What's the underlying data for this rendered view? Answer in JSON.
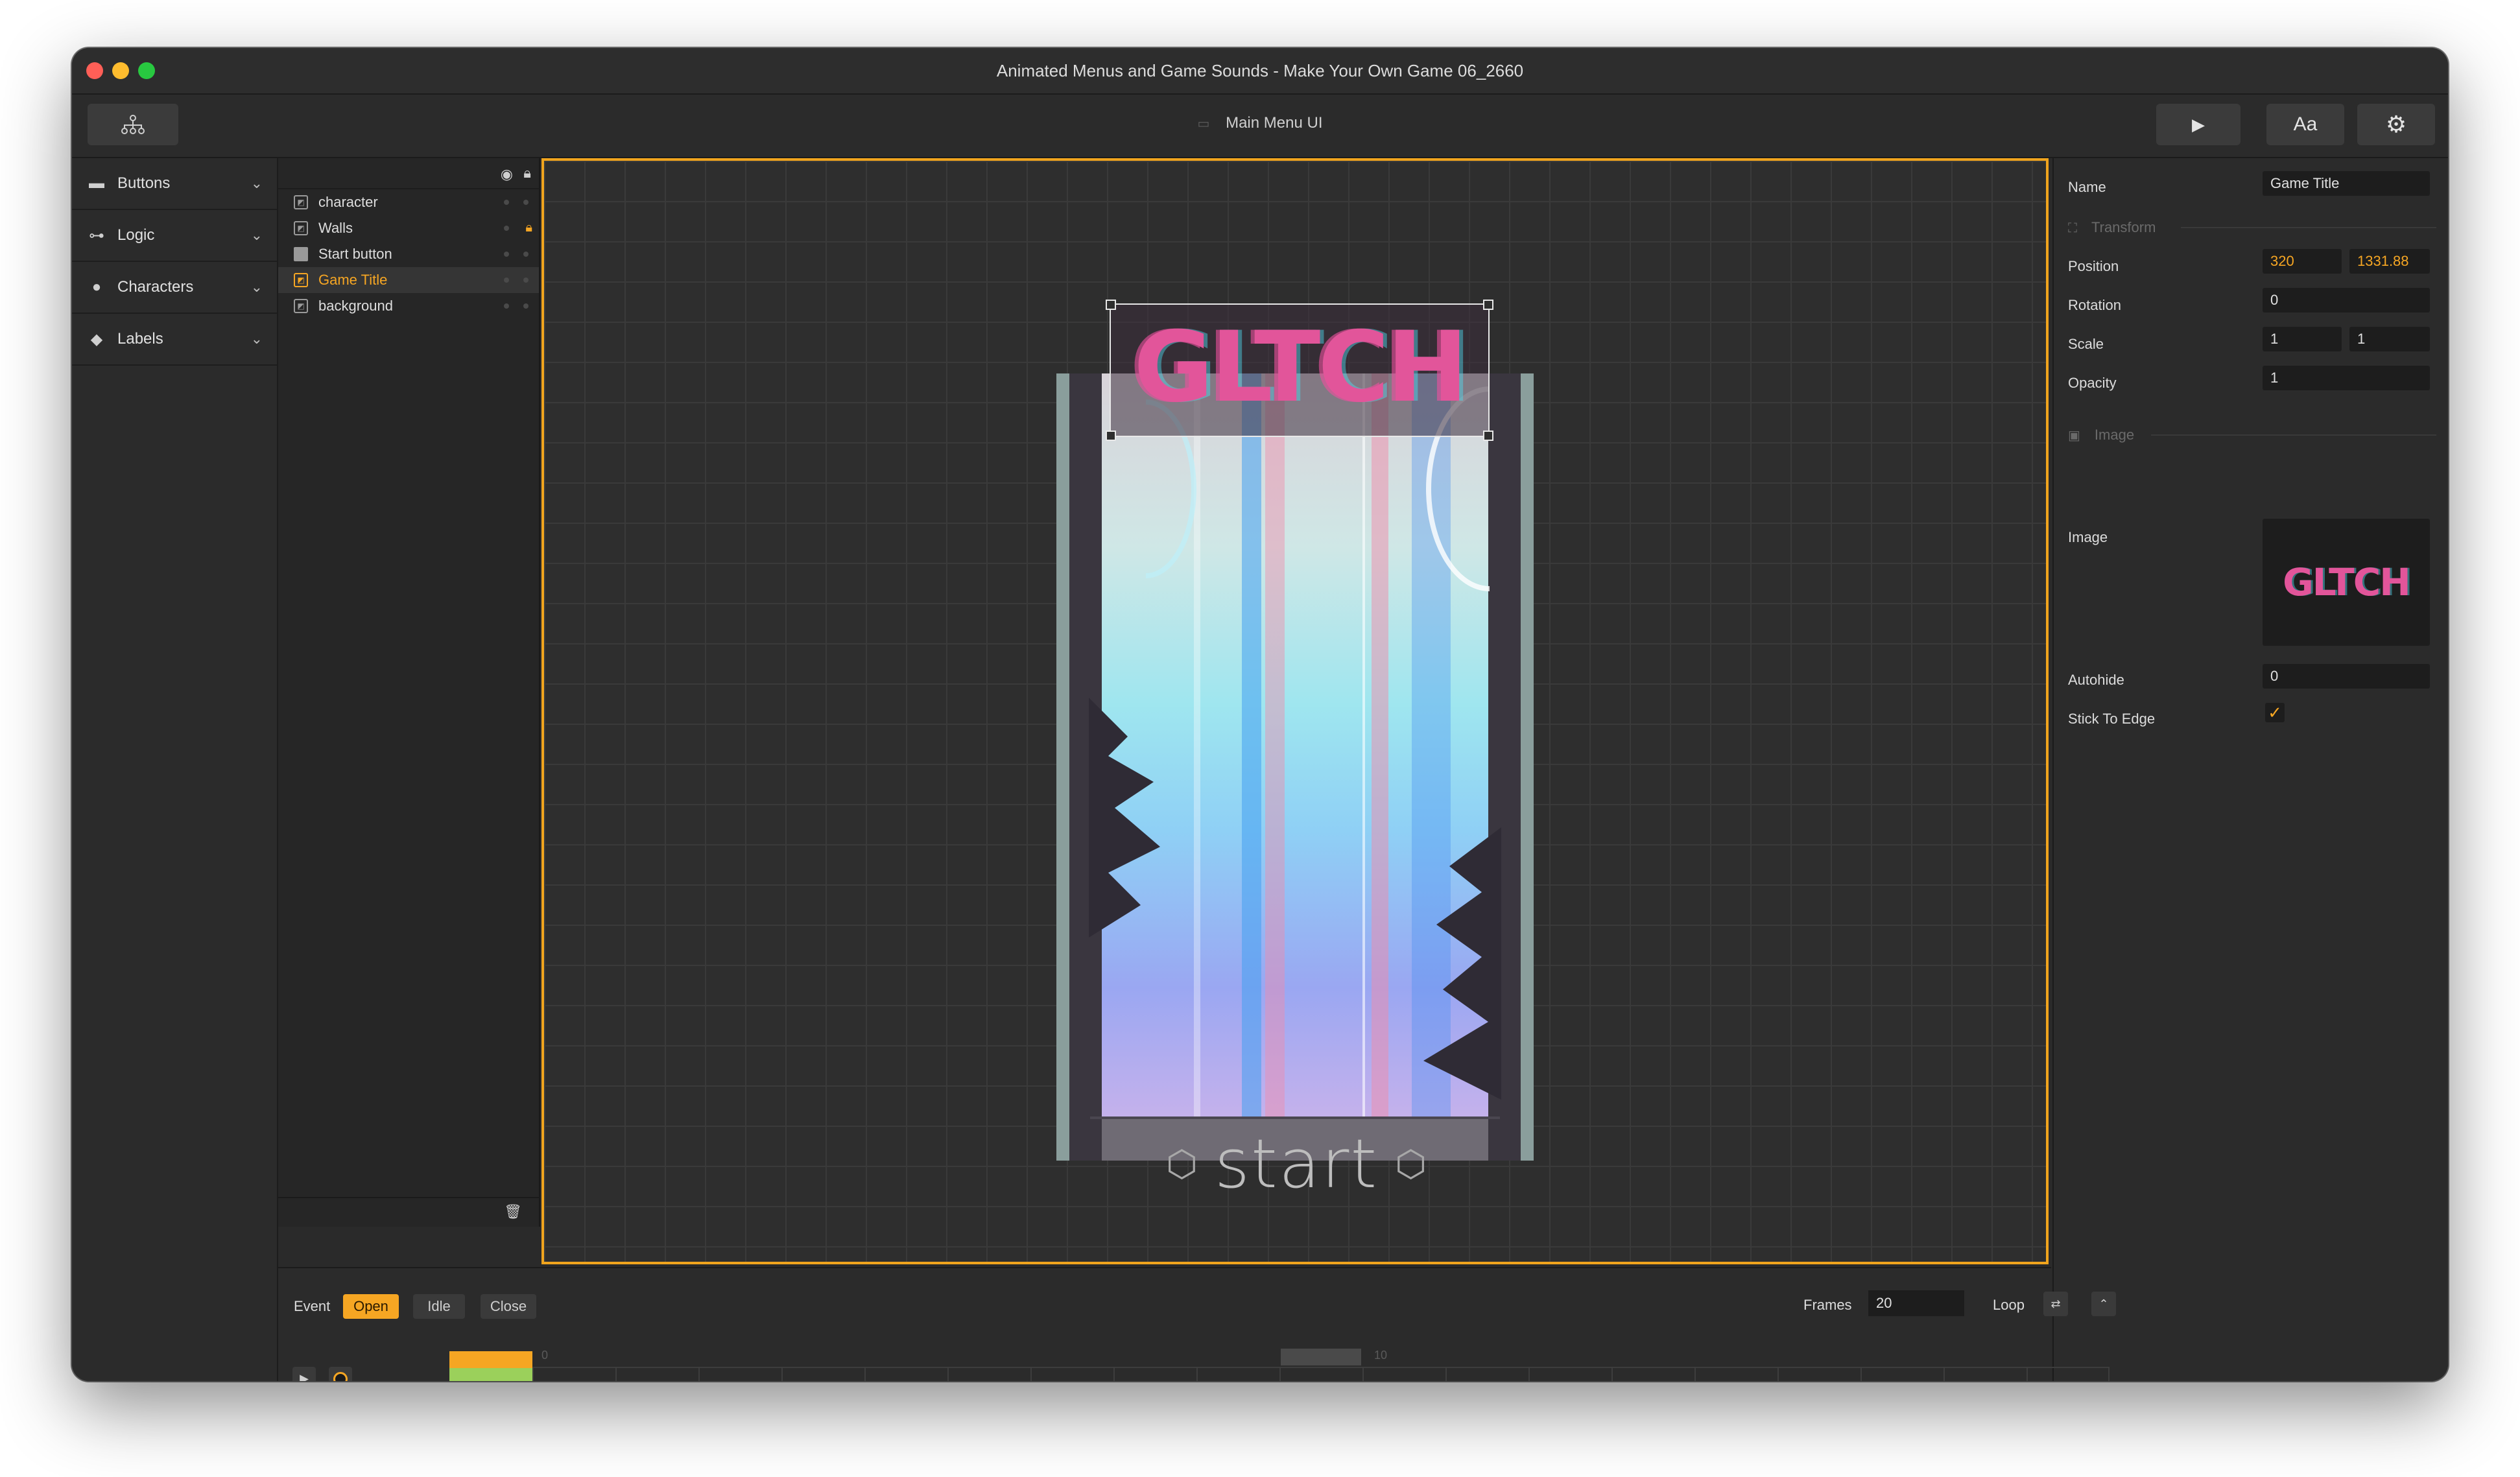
{
  "window": {
    "title": "Animated Menus and Game Sounds - Make Your Own Game 06_2660"
  },
  "toolbar": {
    "hierarchy_icon": "hierarchy-icon",
    "scene_label": "Main Menu UI",
    "play_icon": "▶",
    "text_button": "Aa",
    "settings_icon": "⚙"
  },
  "sidebar": {
    "items": [
      {
        "label": "Buttons",
        "icon": "button-icon"
      },
      {
        "label": "Logic",
        "icon": "logic-icon"
      },
      {
        "label": "Characters",
        "icon": "person-icon"
      },
      {
        "label": "Labels",
        "icon": "tag-icon"
      }
    ]
  },
  "layers": {
    "items": [
      {
        "label": "character",
        "selected": false
      },
      {
        "label": "Walls",
        "selected": false,
        "locked": true
      },
      {
        "label": "Start button",
        "selected": false
      },
      {
        "label": "Game Title",
        "selected": true
      },
      {
        "label": "background",
        "selected": false
      }
    ]
  },
  "canvas": {
    "title_art_text": "GLTCH",
    "start_text": "start"
  },
  "inspector": {
    "name_label": "Name",
    "name_value": "Game Title",
    "transform_section": "Transform",
    "position_label": "Position",
    "position_x": "320",
    "position_y": "1331.88",
    "rotation_label": "Rotation",
    "rotation_value": "0",
    "scale_label": "Scale",
    "scale_x": "1",
    "scale_y": "1",
    "opacity_label": "Opacity",
    "opacity_value": "1",
    "image_section": "Image",
    "image_label": "Image",
    "image_preview_text": "GLTCH",
    "autohide_label": "Autohide",
    "autohide_value": "0",
    "stick_label": "Stick To Edge",
    "stick_checked": "✓"
  },
  "timeline": {
    "event_label": "Event",
    "events": [
      {
        "label": "Open",
        "active": true
      },
      {
        "label": "Idle",
        "active": false
      },
      {
        "label": "Close",
        "active": false
      }
    ],
    "frames_label": "Frames",
    "frames_value": "20",
    "loop_label": "Loop",
    "tick_0": "0",
    "tick_10": "10"
  },
  "colors": {
    "accent": "#f6a623",
    "background": "#2b2b2b",
    "canvas_border": "#f0a41e"
  }
}
